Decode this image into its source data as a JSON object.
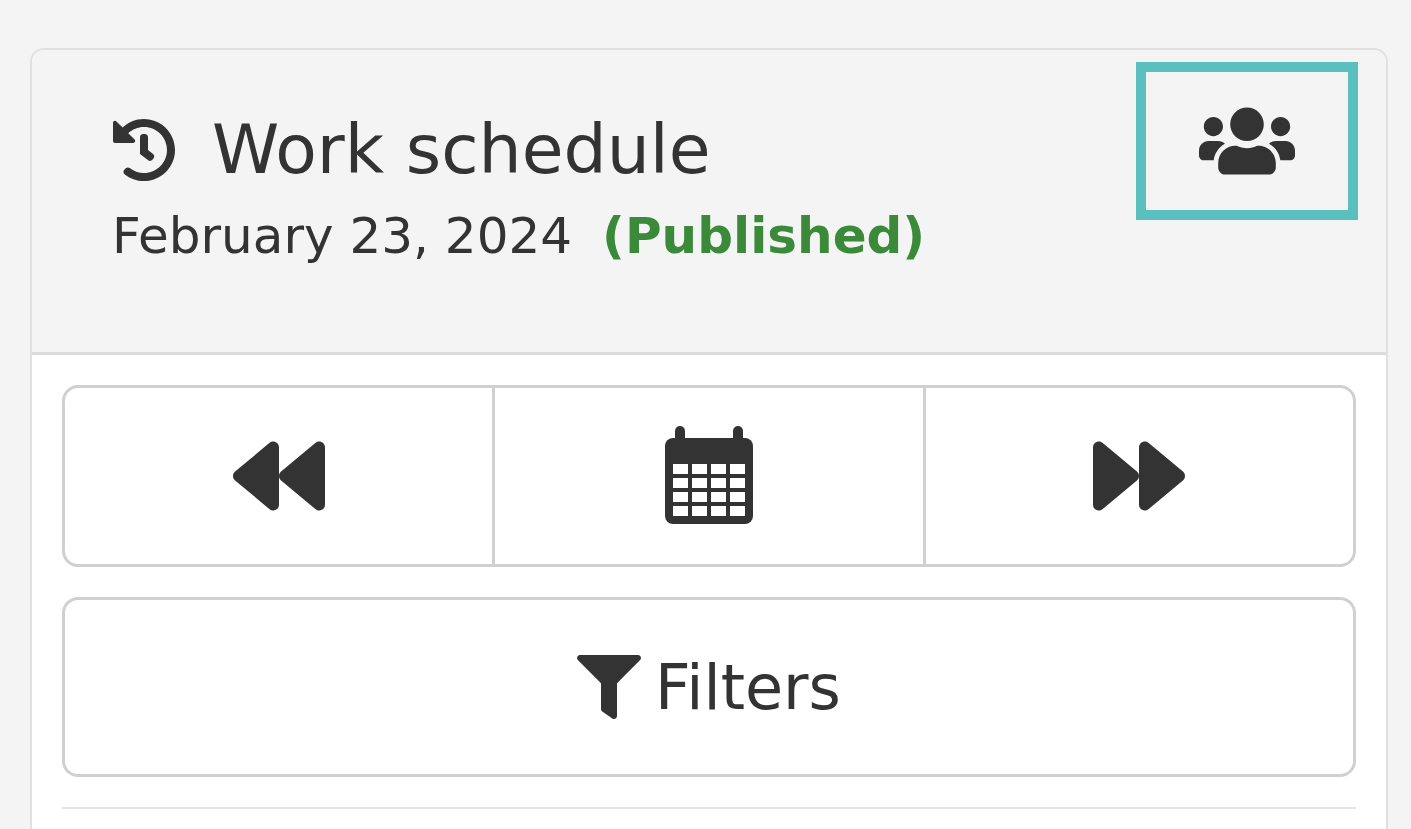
{
  "header": {
    "title": "Work schedule",
    "date": "February 23, 2024",
    "status": {
      "label": "(Published)",
      "kind": "published"
    },
    "team_button": {
      "focused": true
    }
  },
  "navigation": [
    {
      "kind": "previous"
    },
    {
      "kind": "calendar"
    },
    {
      "kind": "next"
    }
  ],
  "filters_button": {
    "label": "Filters"
  }
}
